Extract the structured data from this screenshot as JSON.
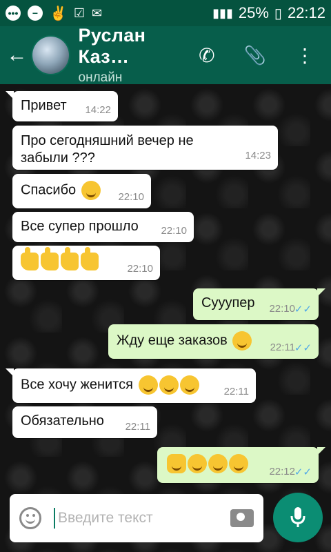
{
  "status_bar": {
    "battery": "25%",
    "time": "22:12"
  },
  "header": {
    "back_icon": "arrow-left-icon",
    "contact_name": "Руслан Каз…",
    "status": "онлайн",
    "call_icon": "phone-icon",
    "attach_icon": "paperclip-icon",
    "menu_icon": "more-vert-icon"
  },
  "messages": [
    {
      "direction": "in",
      "text": "Привет",
      "time": "14:22"
    },
    {
      "direction": "in",
      "text": "Про сегодняшний вечер не забыли ???",
      "time": "14:23"
    },
    {
      "direction": "in",
      "text": "Спасибо",
      "time": "22:10"
    },
    {
      "direction": "in",
      "text": "Все супер прошло",
      "time": "22:10"
    },
    {
      "direction": "in",
      "text": "",
      "time": "22:10"
    },
    {
      "direction": "out",
      "text": "Сууупер",
      "time": "22:10"
    },
    {
      "direction": "out",
      "text": "Жду еще заказов",
      "time": "22:11"
    },
    {
      "direction": "in",
      "text": "Все хочу женится",
      "time": "22:11"
    },
    {
      "direction": "in",
      "text": "Обязательно",
      "time": "22:11"
    },
    {
      "direction": "out",
      "text": "",
      "time": "22:12"
    }
  ],
  "input": {
    "placeholder": "Введите текст",
    "emoji_icon": "smiley-icon",
    "camera_icon": "camera-icon",
    "mic_icon": "microphone-icon"
  },
  "colors": {
    "header": "#075e4b",
    "incoming": "#ffffff",
    "outgoing": "#dcf8c6",
    "read_ticks": "#4fa8e8",
    "mic_button": "#0b8d73"
  }
}
